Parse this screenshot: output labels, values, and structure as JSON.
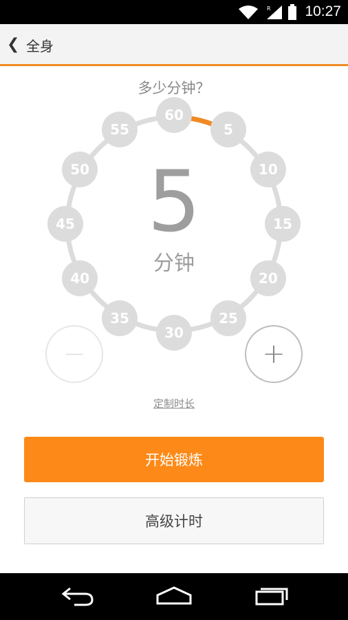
{
  "status_bar": {
    "time": "10:27"
  },
  "header": {
    "back_glyph": "❮",
    "title": "全身"
  },
  "question": "多少分钟？",
  "dial": {
    "ticks": [
      "60",
      "5",
      "10",
      "15",
      "20",
      "25",
      "30",
      "35",
      "40",
      "45",
      "50",
      "55"
    ],
    "selected_minutes": 5,
    "value_display": "5",
    "unit": "分钟",
    "accent_color": "#f08a22"
  },
  "controls": {
    "minus_label": "−",
    "plus_label": "+"
  },
  "custom_link": "定制时长",
  "start_button": "开始锻炼",
  "advanced_button": "高级计时",
  "colors": {
    "primary": "#fd8a18",
    "tick": "#dcdcdc",
    "ring": "#dcdcdc"
  }
}
